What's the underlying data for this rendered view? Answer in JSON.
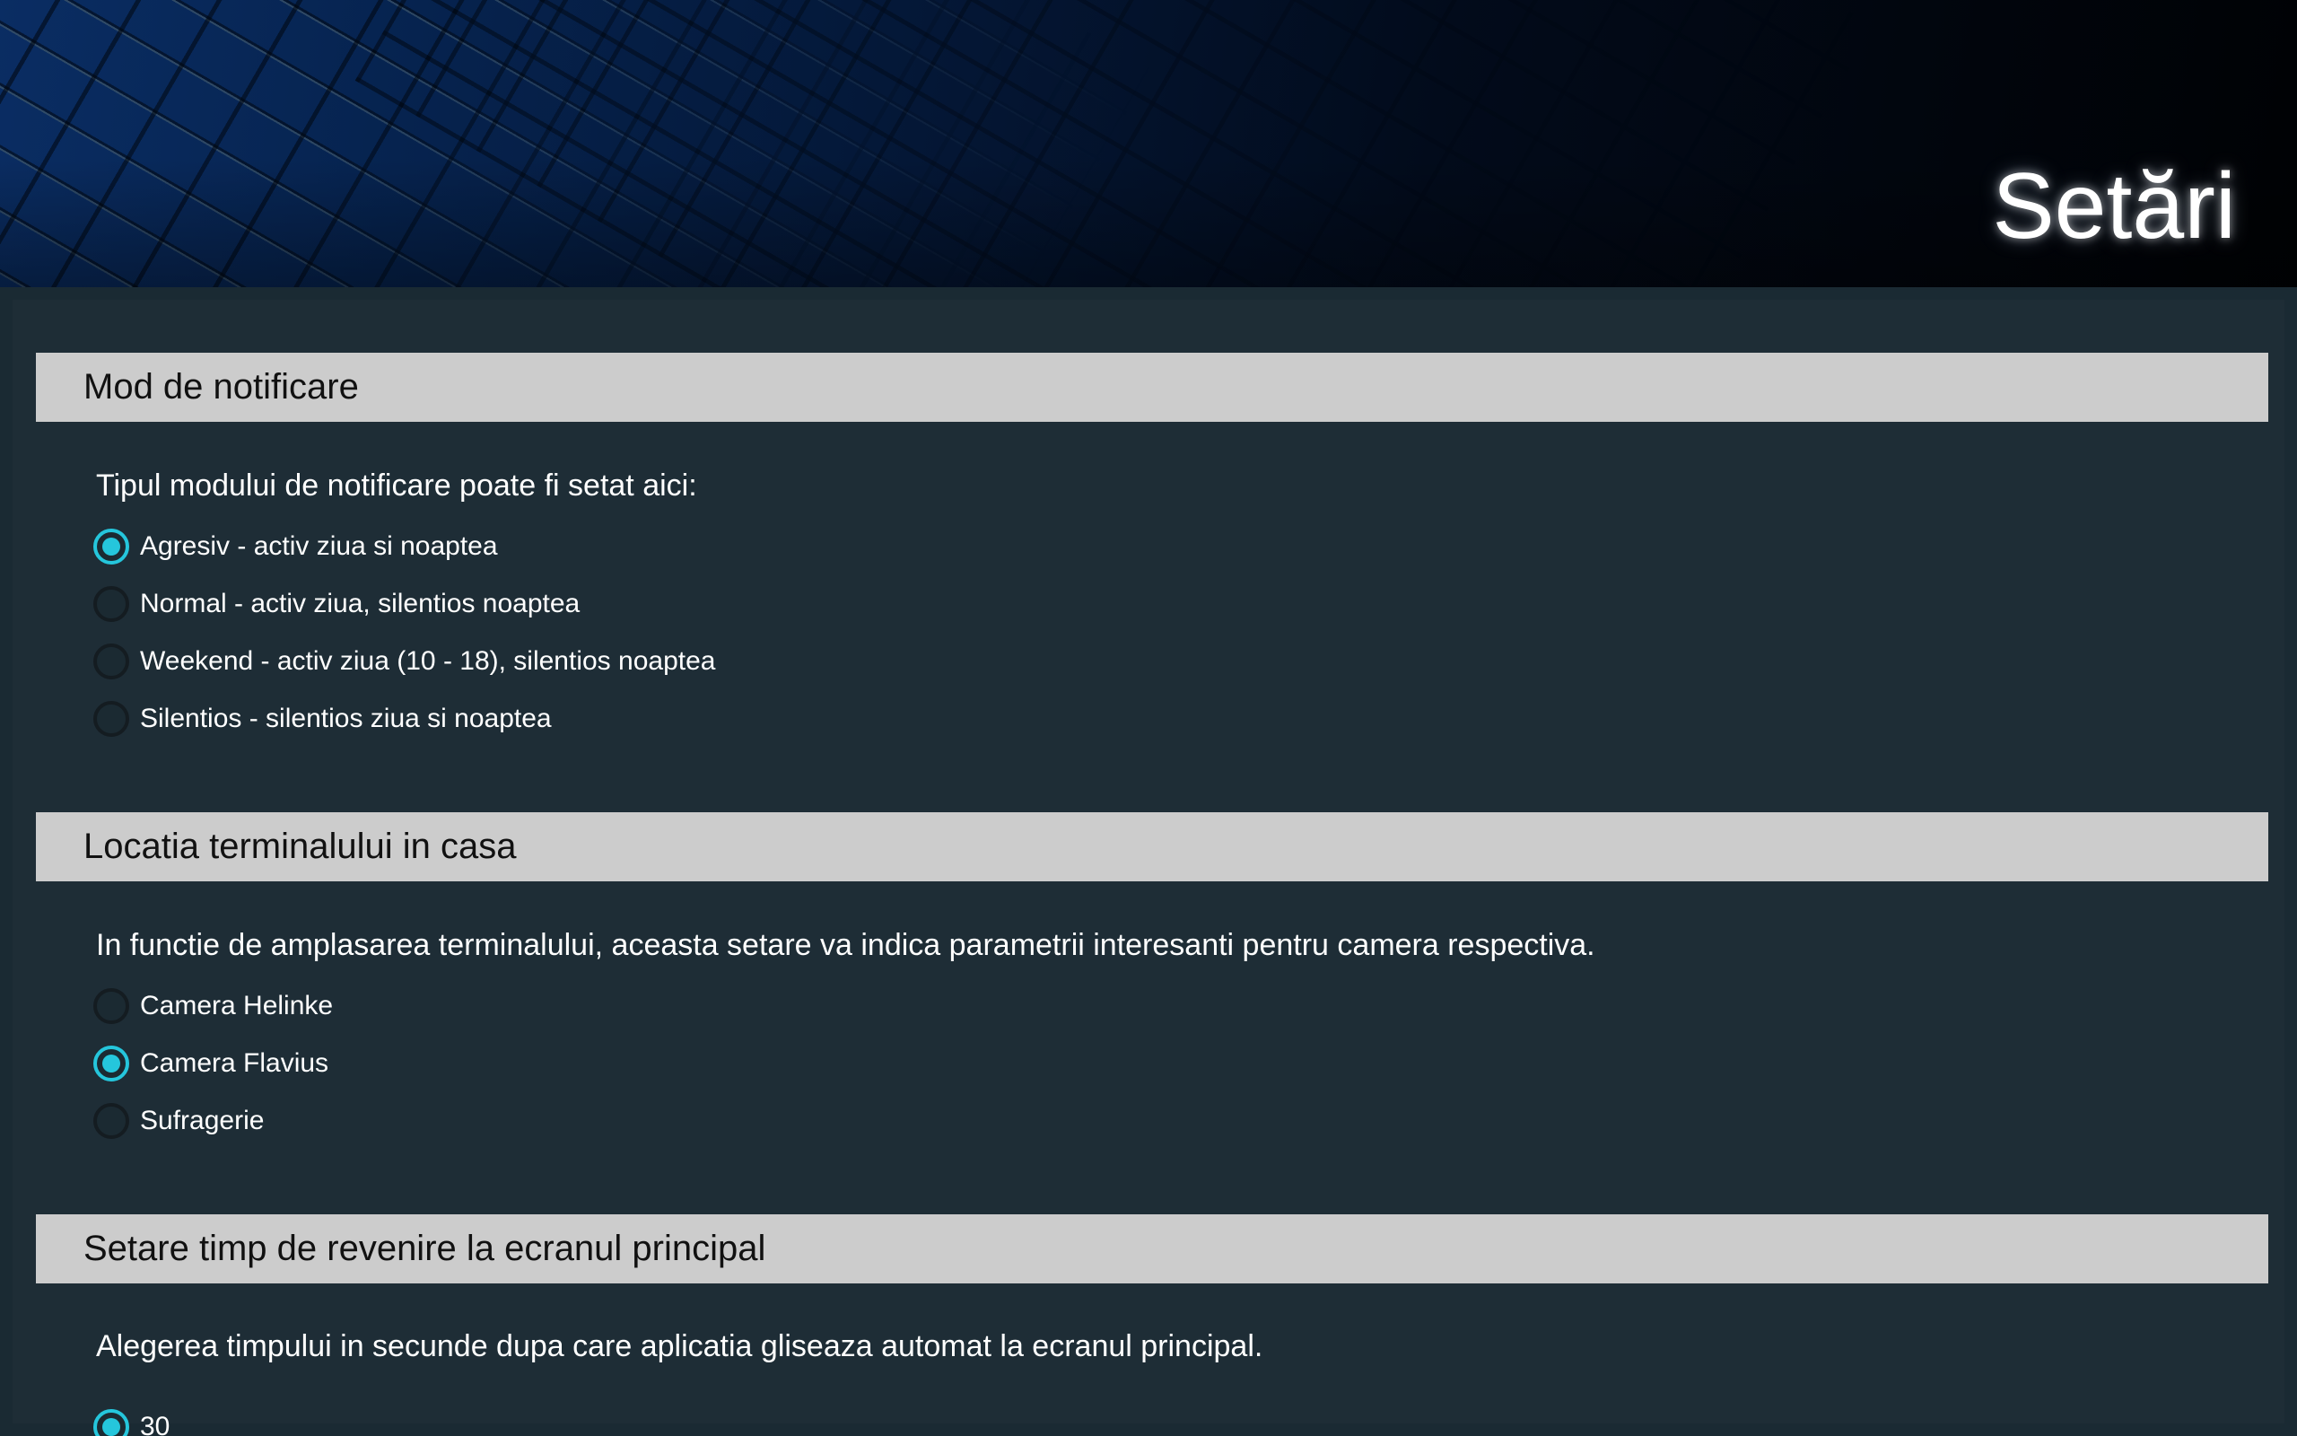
{
  "header": {
    "title": "Setări"
  },
  "colors": {
    "accent": "#25c6dc",
    "panel_background": "#1e2d36",
    "section_header_background": "#cccccc"
  },
  "sections": [
    {
      "title": "Mod de notificare",
      "description": "Tipul modului de notificare poate fi setat aici:",
      "selected_index": 0,
      "options": [
        "Agresiv - activ ziua si noaptea",
        "Normal - activ ziua, silentios noaptea",
        "Weekend - activ ziua (10 - 18), silentios noaptea",
        "Silentios - silentios ziua si noaptea"
      ]
    },
    {
      "title": "Locatia terminalului in casa",
      "description": "In functie de amplasarea terminalului, aceasta setare va indica parametrii interesanti pentru camera respectiva.",
      "selected_index": 1,
      "options": [
        "Camera Helinke",
        "Camera Flavius",
        "Sufragerie"
      ]
    },
    {
      "title": "Setare timp de revenire la ecranul principal",
      "description": "Alegerea timpului in secunde dupa care aplicatia gliseaza automat la ecranul principal.",
      "selected_index": 0,
      "options": [
        "30"
      ]
    }
  ]
}
